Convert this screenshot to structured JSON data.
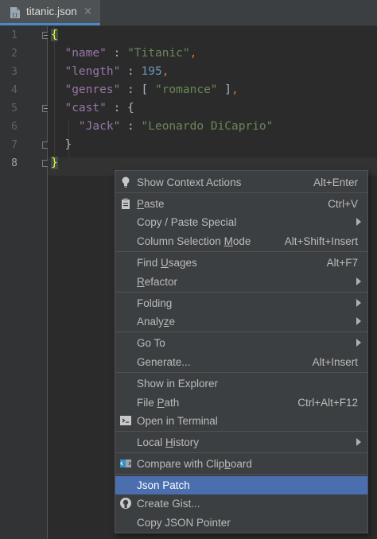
{
  "tab": {
    "filename": "titanic.json",
    "close": "×"
  },
  "line_numbers": [
    "1",
    "2",
    "3",
    "4",
    "5",
    "6",
    "7",
    "8"
  ],
  "code": {
    "l1_brace": "{",
    "l2_key": "\"name\"",
    "l2_colon": " : ",
    "l2_val": "\"Titanic\"",
    "l2_comma": ",",
    "l3_key": "\"length\"",
    "l3_colon": " : ",
    "l3_val": "195",
    "l3_comma": ",",
    "l4_key": "\"genres\"",
    "l4_colon": " : [ ",
    "l4_val": "\"romance\"",
    "l4_end": " ]",
    "l4_comma": ",",
    "l5_key": "\"cast\"",
    "l5_colon": " : {",
    "l6_key": "\"Jack\"",
    "l6_colon": " : ",
    "l6_val": "\"Leonardo DiCaprio\"",
    "l7_brace": "}",
    "l8_brace": "}"
  },
  "menu": {
    "show_context_actions": {
      "label": "Show Context Actions",
      "shortcut": "Alt+Enter",
      "icon": "lightbulb-icon"
    },
    "paste": {
      "label_u": "P",
      "label_rest": "aste",
      "shortcut": "Ctrl+V",
      "icon": "clipboard-icon"
    },
    "copy_paste_special": {
      "label": "Copy / Paste Special"
    },
    "column_selection_mode": {
      "label_pre": "Column Selection ",
      "label_u": "M",
      "label_rest": "ode",
      "shortcut": "Alt+Shift+Insert"
    },
    "find_usages": {
      "label_pre": "Find ",
      "label_u": "U",
      "label_rest": "sages",
      "shortcut": "Alt+F7"
    },
    "refactor": {
      "label_u": "R",
      "label_rest": "efactor"
    },
    "folding": {
      "label": "Folding"
    },
    "analyze": {
      "label_pre": "Analy",
      "label_u": "z",
      "label_rest": "e"
    },
    "go_to": {
      "label": "Go To"
    },
    "generate": {
      "label": "Generate...",
      "shortcut": "Alt+Insert"
    },
    "show_in_explorer": {
      "label": "Show in Explorer"
    },
    "file_path": {
      "label_pre": "File ",
      "label_u": "P",
      "label_rest": "ath",
      "shortcut": "Ctrl+Alt+F12"
    },
    "open_in_terminal": {
      "label": "Open in Terminal",
      "icon": "terminal-icon"
    },
    "local_history": {
      "label_pre": "Local ",
      "label_u": "H",
      "label_rest": "istory"
    },
    "compare_with_clipboard": {
      "label_pre": "Compare with Clip",
      "label_u": "b",
      "label_rest": "oard",
      "icon": "compare-icon"
    },
    "json_patch": {
      "label": "Json Patch"
    },
    "create_gist": {
      "label": "Create Gist...",
      "icon": "github-icon"
    },
    "copy_json_pointer": {
      "label": "Copy JSON Pointer"
    }
  },
  "colors": {
    "accent": "#4b6eaf",
    "tab_underline": "#4a88c7",
    "bracket_match": "#ffef28"
  }
}
